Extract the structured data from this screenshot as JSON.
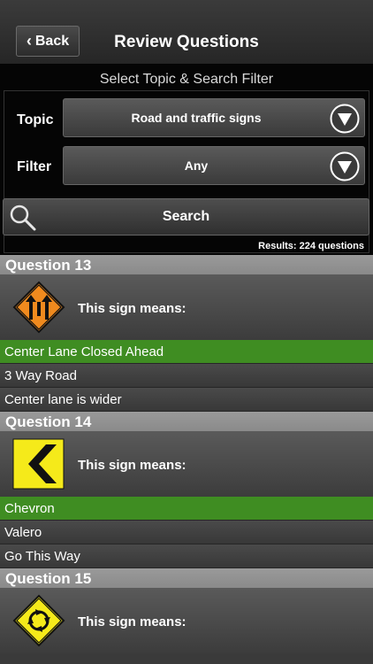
{
  "nav": {
    "back_label": "Back",
    "title": "Review Questions"
  },
  "filter": {
    "heading": "Select Topic & Search Filter",
    "topic_label": "Topic",
    "topic_value": "Road and traffic signs",
    "filter_label": "Filter",
    "filter_value": "Any",
    "search_label": "Search",
    "results": "Results: 224 questions"
  },
  "questions": [
    {
      "title": "Question 13",
      "prompt": "This sign means:",
      "sign_icon": "center-lane-closed-sign-icon",
      "answers": [
        "Center Lane Closed Ahead",
        "3 Way Road",
        "Center lane is wider"
      ]
    },
    {
      "title": "Question 14",
      "prompt": "This sign means:",
      "sign_icon": "chevron-sign-icon",
      "answers": [
        "Chevron",
        "Valero",
        "Go This Way"
      ]
    },
    {
      "title": "Question 15",
      "prompt": "This sign means:",
      "sign_icon": "roundabout-sign-icon",
      "answers": []
    }
  ],
  "colors": {
    "correct_answer": "#3f8d22",
    "question_header": "#8f8f8f",
    "warning_orange": "#f08a1e",
    "warning_yellow": "#f5ea1a"
  }
}
